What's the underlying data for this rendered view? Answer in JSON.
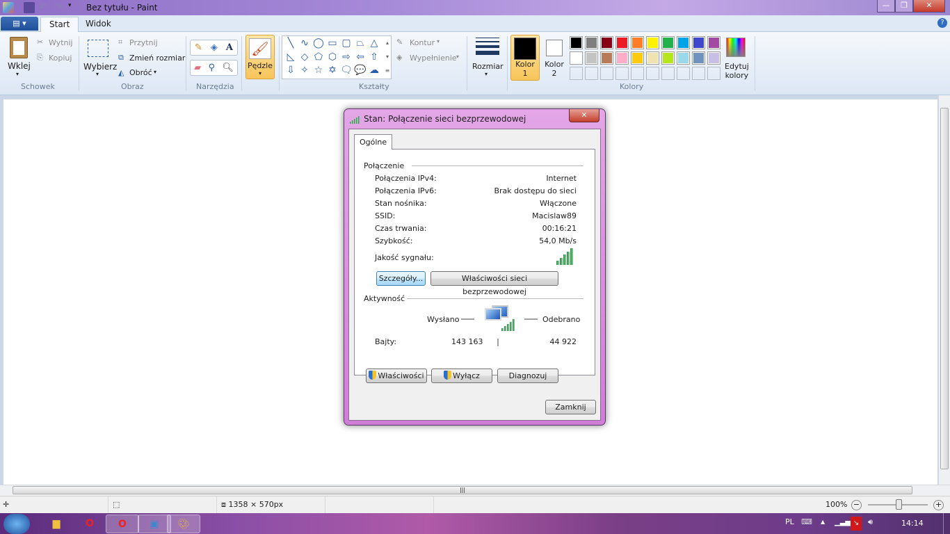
{
  "window": {
    "title": "Bez tytułu - Paint",
    "min": "—",
    "max": "❐",
    "close": "✕"
  },
  "ribbon": {
    "tabs": [
      "Start",
      "Widok"
    ],
    "clipboard": {
      "paste": "Wklej",
      "cut": "Wytnij",
      "copy": "Kopiuj",
      "group": "Schowek"
    },
    "image": {
      "select": "Wybierz",
      "crop": "Przytnij",
      "resize": "Zmień rozmiar",
      "rotate": "Obróć",
      "group": "Obraz"
    },
    "tools": {
      "group": "Narzędzia"
    },
    "brushes": {
      "label": "Pędzle"
    },
    "shapes": {
      "outline": "Kontur",
      "fill": "Wypełnienie",
      "group": "Kształty",
      "glyphs": [
        "╲",
        "∿",
        "◯",
        "▭",
        "▢",
        "⏢",
        "△",
        "◺",
        "◇",
        "⬠",
        "⬡",
        "⇨",
        "⇦",
        "⇧",
        "⇩",
        "✧",
        "☆",
        "✡",
        "🗨",
        "💬",
        "☁"
      ]
    },
    "size": {
      "label": "Rozmiar"
    },
    "colors": {
      "color1": "Kolor",
      "color1_num": "1",
      "color2": "Kolor",
      "color2_num": "2",
      "edit": "Edytuj",
      "edit2": "kolory",
      "group": "Kolory",
      "color1_value": "#000000",
      "color2_value": "#ffffff",
      "palette": [
        "#000000",
        "#7f7f7f",
        "#880015",
        "#ed1c24",
        "#ff7f27",
        "#fff200",
        "#22b14c",
        "#00a2e8",
        "#3f48cc",
        "#a349a4",
        "#ffffff",
        "#c3c3c3",
        "#b97a57",
        "#ffaec9",
        "#ffc90e",
        "#efe4b0",
        "#b5e61d",
        "#99d9ea",
        "#7092be",
        "#c8bfe7"
      ]
    }
  },
  "dialog": {
    "title": "Stan: Połączenie sieci bezprzewodowej",
    "tab": "Ogólne",
    "connection_header": "Połączenie",
    "rows": [
      {
        "k": "Połączenia IPv4:",
        "v": "Internet"
      },
      {
        "k": "Połączenia IPv6:",
        "v": "Brak dostępu do sieci"
      },
      {
        "k": "Stan nośnika:",
        "v": "Włączone"
      },
      {
        "k": "SSID:",
        "v": "Macislaw89"
      },
      {
        "k": "Czas trwania:",
        "v": "00:16:21"
      },
      {
        "k": "Szybkość:",
        "v": "54,0 Mb/s"
      }
    ],
    "signal_label": "Jakość sygnału:",
    "signal_level": 5,
    "details_btn": "Szczegóły...",
    "wireless_props_btn": "Właściwości sieci bezprzewodowej",
    "activity_header": "Aktywność",
    "sent": "Wysłano",
    "received": "Odebrano",
    "bytes_label": "Bajty:",
    "bytes_sent": "143 163",
    "bytes_received": "44 922",
    "properties_btn": "Właściwości",
    "disable_btn": "Wyłącz",
    "diagnose_btn": "Diagnozuj",
    "close_btn": "Zamknij"
  },
  "status": {
    "size": "1358 × 570px",
    "zoom": "100%"
  },
  "taskbar": {
    "lang": "PL",
    "time": "14:14"
  }
}
